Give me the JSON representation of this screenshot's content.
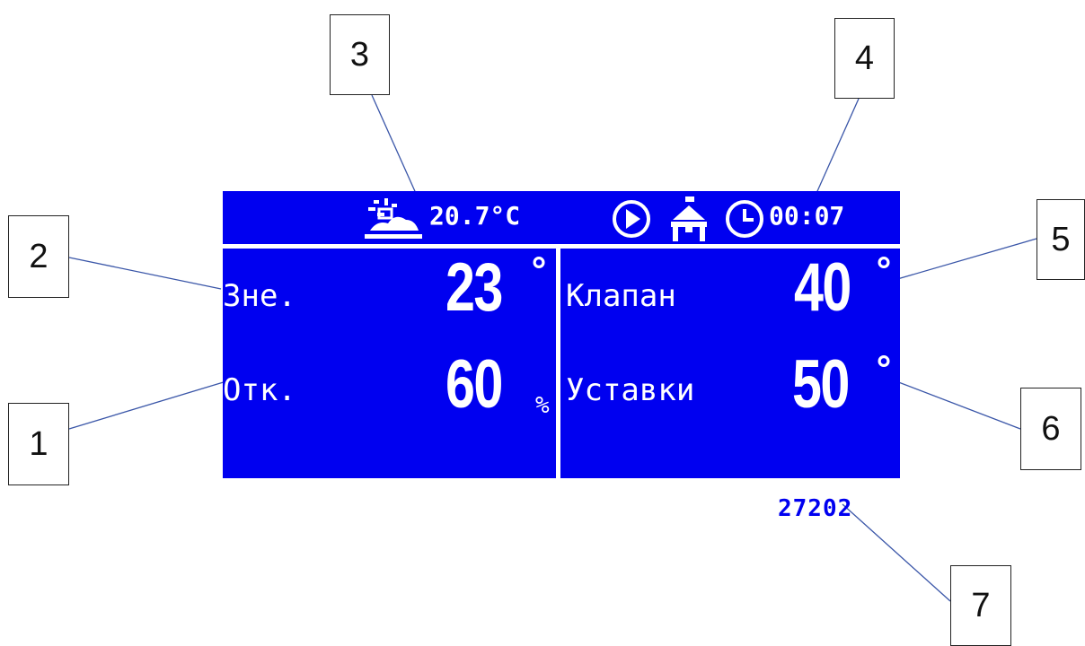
{
  "lcd": {
    "outdoor_temp_top": "20.7°C",
    "clock": "00:07",
    "left": {
      "row1_label": "Зне.",
      "row1_value": "23",
      "row1_unit": "°",
      "row2_label": "Отк.",
      "row2_value": "60",
      "row2_unit": "%"
    },
    "right": {
      "row1_label": "Клапан",
      "row1_value": "40",
      "row1_unit": "°",
      "row2_label": "Уставки",
      "row2_value": "50",
      "row2_unit": "°"
    },
    "colors": {
      "screen": "#0000f0",
      "text": "#ffffff"
    },
    "icons": [
      "weather-icon",
      "pump-icon",
      "valve-icon",
      "clock-icon"
    ]
  },
  "code_label": "27202",
  "callouts": [
    "1",
    "2",
    "3",
    "4",
    "5",
    "6",
    "7"
  ]
}
